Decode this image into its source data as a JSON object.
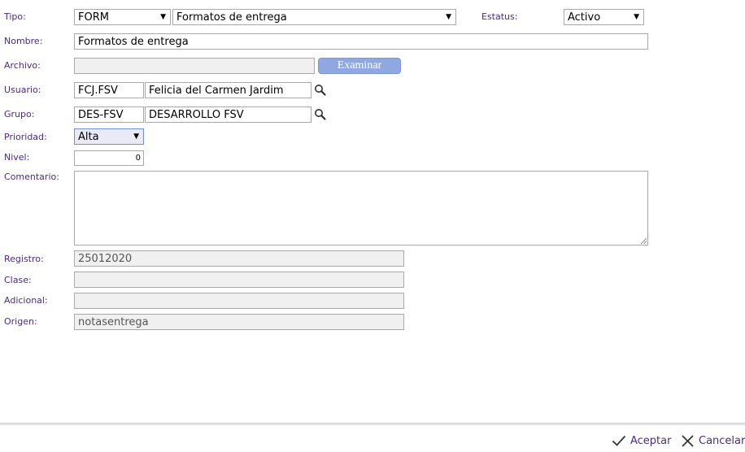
{
  "form": {
    "tipo_label": "Tipo:",
    "tipo_value": "FORM",
    "tipo_desc": "Formatos de entrega",
    "estatus_label": "Estatus:",
    "estatus_value": "Activo",
    "nombre_label": "Nombre:",
    "nombre_value": "Formatos de entrega",
    "archivo_label": "Archivo:",
    "archivo_value": "",
    "examinar_label": "Examinar",
    "usuario_label": "Usuario:",
    "usuario_code": "FCJ.FSV",
    "usuario_name": "Felicia del Carmen Jardim",
    "grupo_label": "Grupo:",
    "grupo_code": "DES-FSV",
    "grupo_name": "DESARROLLO FSV",
    "prioridad_label": "Prioridad:",
    "prioridad_value": "Alta",
    "nivel_label": "Nivel:",
    "nivel_value": "0",
    "comentario_label": "Comentario:",
    "comentario_value": "",
    "registro_label": "Registro:",
    "registro_value": "25012020",
    "clase_label": "Clase:",
    "clase_value": "",
    "adicional_label": "Adicional:",
    "adicional_value": "",
    "origen_label": "Origen:",
    "origen_value": "notasentrega"
  },
  "footer": {
    "accept_label": "Aceptar",
    "cancel_label": "Cancelar"
  },
  "icons": {
    "search": "magnifier-icon",
    "accept": "checkmark-icon",
    "cancel": "close-icon"
  },
  "colors": {
    "label": "#4a2a86",
    "button": "#8fa8e2",
    "readonly": "#f0f0f0"
  }
}
